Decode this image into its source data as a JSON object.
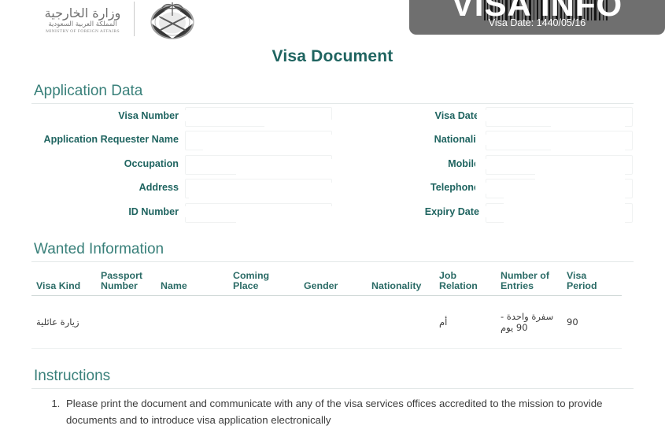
{
  "header": {
    "ministry_logo": {
      "arabic_name": "وزارة الخارجية",
      "arabic_country": "المملكة العربية السعودية",
      "english_name": "MINISTRY OF FOREIGN AFFAIRS"
    },
    "emblem_name": "saudi-national-emblem",
    "badge": {
      "title": "VISA INFO",
      "subtitle": "Visa Date: 1440/05/16",
      "background_color": "#6f6f6f"
    }
  },
  "document": {
    "title": "Visa Document",
    "accent_color": "#1f6460",
    "heading_color": "#39807a"
  },
  "application_data": {
    "heading": "Application Data",
    "rows": [
      {
        "left_label": "Visa Number",
        "left_value": "",
        "right_label": "Visa Date",
        "right_value": ""
      },
      {
        "left_label": "Application Requester Name",
        "left_value": "",
        "right_label": "Nationalit",
        "right_value": ""
      },
      {
        "left_label": "Occupation",
        "left_value": "",
        "right_label": "Mobile",
        "right_value": ""
      },
      {
        "left_label": "Address",
        "left_value": "",
        "right_label": "Telephone",
        "right_value": ""
      },
      {
        "left_label": "ID Number",
        "left_value": "",
        "right_label": "Expiry Date",
        "right_value": ""
      }
    ]
  },
  "wanted_information": {
    "heading": "Wanted Information",
    "columns": [
      "Visa Kind",
      "Passport Number",
      "Name",
      "Coming Place",
      "Gender",
      "Nationality",
      "Job Relation",
      "Number of Entries",
      "Visa Period"
    ],
    "rows": [
      {
        "visa_kind": "زيارة عائلية",
        "passport_number": "",
        "name": "",
        "coming_place": "",
        "gender": "",
        "nationality": "",
        "job_relation": "أم",
        "number_of_entries": "سفرة واحدة - 90 يوم",
        "visa_period": "90"
      }
    ]
  },
  "instructions": {
    "heading": "Instructions",
    "items": [
      "Please print the document and communicate with any of the visa services offices accredited to the mission to provide documents and to introduce visa application electronically"
    ]
  }
}
